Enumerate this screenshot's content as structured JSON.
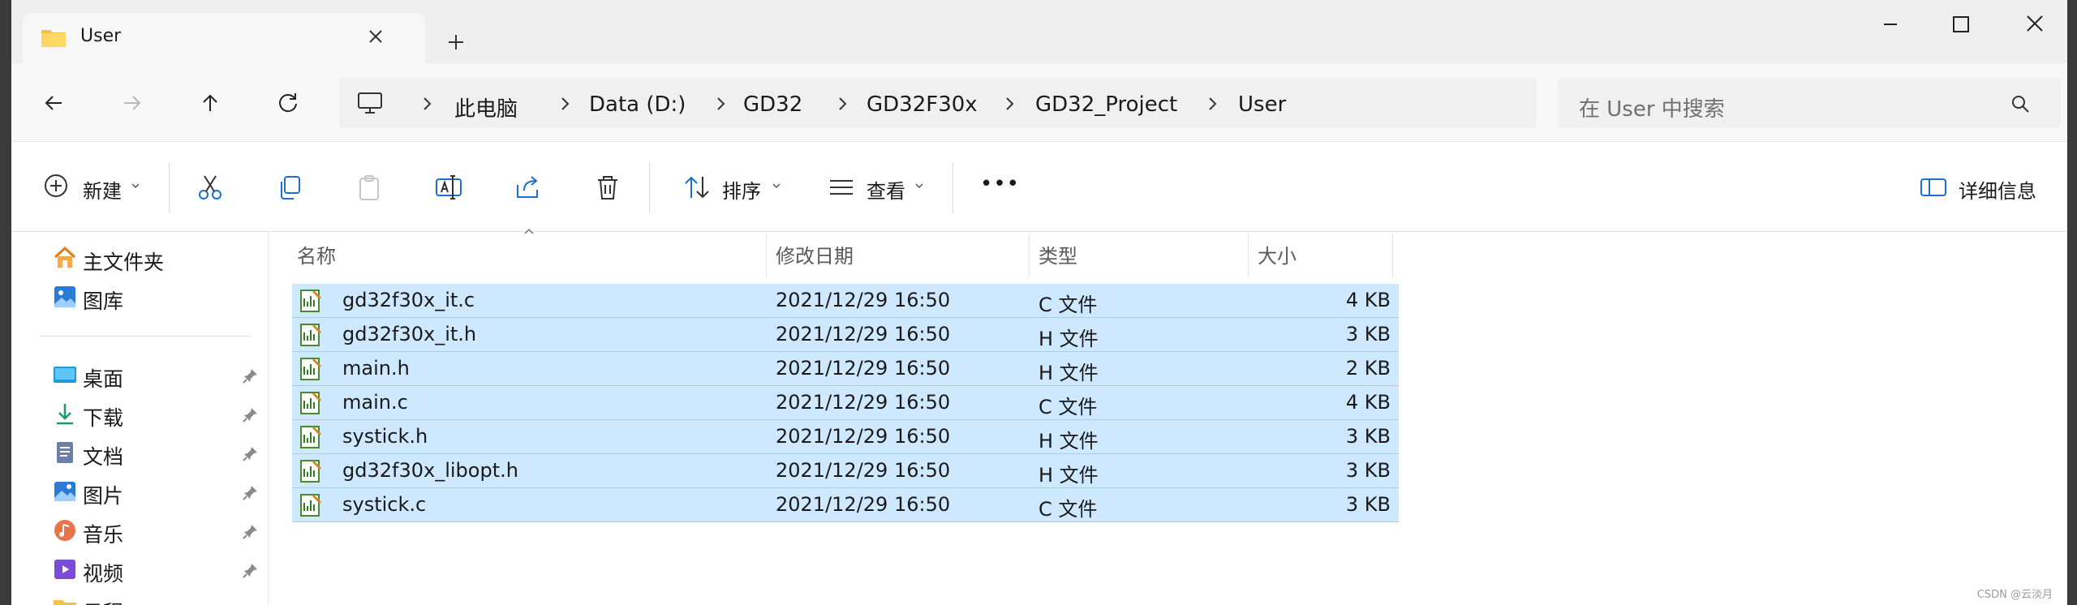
{
  "tab": {
    "title": "User",
    "icon": "folder-icon"
  },
  "breadcrumb": [
    "此电脑",
    "Data (D:)",
    "GD32",
    "GD32F30x",
    "GD32_Project",
    "User"
  ],
  "search": {
    "placeholder": "在 User 中搜索"
  },
  "toolbar": {
    "new_label": "新建",
    "sort_label": "排序",
    "view_label": "查看",
    "more_label": "•••",
    "details_label": "详细信息"
  },
  "sidebar": {
    "top": [
      {
        "label": "主文件夹",
        "icon": "home-icon"
      },
      {
        "label": "图库",
        "icon": "gallery-icon"
      }
    ],
    "pinned": [
      {
        "label": "桌面",
        "icon": "desktop-icon"
      },
      {
        "label": "下载",
        "icon": "download-icon"
      },
      {
        "label": "文档",
        "icon": "document-icon"
      },
      {
        "label": "图片",
        "icon": "pictures-icon"
      },
      {
        "label": "音乐",
        "icon": "music-icon"
      },
      {
        "label": "视频",
        "icon": "video-icon"
      },
      {
        "label": "日程",
        "icon": "folder-icon"
      }
    ]
  },
  "columns": {
    "name": "名称",
    "modified": "修改日期",
    "type": "类型",
    "size": "大小"
  },
  "files": [
    {
      "name": "gd32f30x_it.c",
      "modified": "2021/12/29 16:50",
      "type": "C 文件",
      "size": "4 KB"
    },
    {
      "name": "gd32f30x_it.h",
      "modified": "2021/12/29 16:50",
      "type": "H 文件",
      "size": "3 KB"
    },
    {
      "name": "main.h",
      "modified": "2021/12/29 16:50",
      "type": "H 文件",
      "size": "2 KB"
    },
    {
      "name": "main.c",
      "modified": "2021/12/29 16:50",
      "type": "C 文件",
      "size": "4 KB"
    },
    {
      "name": "systick.h",
      "modified": "2021/12/29 16:50",
      "type": "H 文件",
      "size": "3 KB"
    },
    {
      "name": "gd32f30x_libopt.h",
      "modified": "2021/12/29 16:50",
      "type": "H 文件",
      "size": "3 KB"
    },
    {
      "name": "systick.c",
      "modified": "2021/12/29 16:50",
      "type": "C 文件",
      "size": "3 KB"
    }
  ],
  "watermark": "CSDN @云淡月",
  "colors": {
    "selection": "#cde8ff",
    "selection_border": "#99d1ff",
    "accent": "#1c6fd1"
  }
}
